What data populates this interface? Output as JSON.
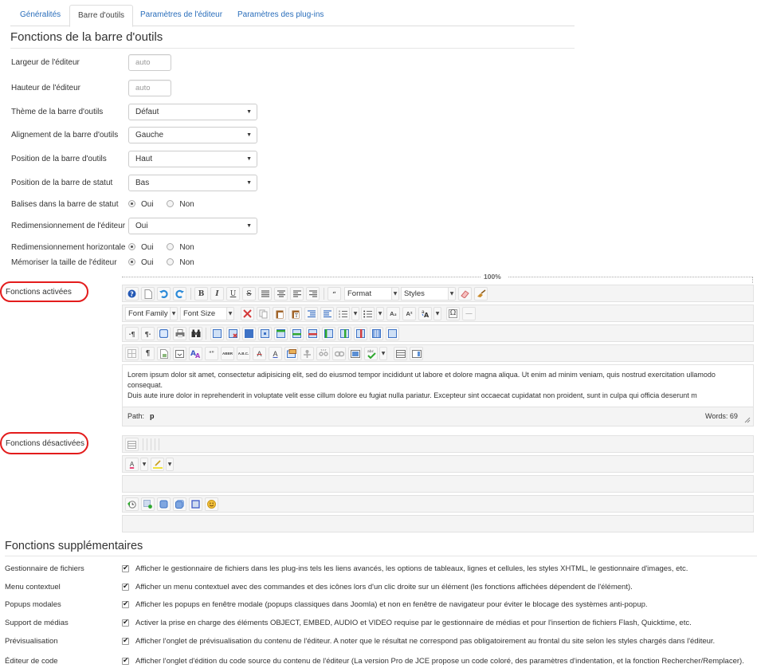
{
  "tabs": [
    {
      "label": "Généralités",
      "active": false
    },
    {
      "label": "Barre d'outils",
      "active": true
    },
    {
      "label": "Paramètres de l'éditeur",
      "active": false
    },
    {
      "label": "Paramètres des plug-ins",
      "active": false
    }
  ],
  "section1": {
    "title": "Fonctions de la barre d'outils",
    "fields": {
      "width": {
        "label": "Largeur de l'éditeur",
        "placeholder": "auto"
      },
      "height": {
        "label": "Hauteur de l'éditeur",
        "placeholder": "auto"
      },
      "theme": {
        "label": "Thème de la barre d'outils",
        "value": "Défaut"
      },
      "align": {
        "label": "Alignement de la barre d'outils",
        "value": "Gauche"
      },
      "position": {
        "label": "Position de la barre d'outils",
        "value": "Haut"
      },
      "status_position": {
        "label": "Position de la barre de statut",
        "value": "Bas"
      },
      "status_tags": {
        "label": "Balises dans la barre de statut",
        "yes": "Oui",
        "no": "Non",
        "selected": "Oui"
      },
      "resize": {
        "label": "Redimensionnement de l'éditeur",
        "value": "Oui"
      },
      "resize_h": {
        "label": "Redimensionnement horizontale",
        "yes": "Oui",
        "no": "Non",
        "selected": "Oui"
      },
      "remember_size": {
        "label": "Mémoriser la taille de l'éditeur",
        "yes": "Oui",
        "no": "Non",
        "selected": "Oui"
      }
    },
    "caret": "▼"
  },
  "editor": {
    "enabled_label": "Fonctions activées",
    "disabled_label": "Fonctions désactivées",
    "zoom": "100%",
    "format_label": "Format",
    "styles_label": "Styles",
    "font_family_label": "Font Family",
    "font_size_label": "Font Size",
    "content_line1": "Lorem ipsum dolor sit amet, consectetur adipisicing elit, sed do eiusmod tempor incididunt ut labore et dolore magna aliqua. Ut enim ad minim veniam, quis nostrud exercitation ullamodo consequat.",
    "content_line2": "Duis aute irure dolor in reprehenderit in voluptate velit esse cillum dolore eu fugiat nulla pariatur. Excepteur sint occaecat cupidatat non proident, sunt in culpa qui officia deserunt m",
    "path_label": "Path:",
    "path_value": "p",
    "words_label": "Words: 69",
    "glyphs": {
      "help": "?",
      "bold": "B",
      "italic": "I",
      "underline": "U",
      "strike": "S",
      "blockquote": "“",
      "sub": "A₂",
      "sup": "A²",
      "omega": "Ω",
      "hr": "—",
      "ltr": "·¶",
      "rtl": "¶·",
      "pilcrow": "¶",
      "quote": "“”",
      "abbr": "ABBR",
      "acronym": "A.B.C.",
      "del": "A",
      "ins": "A",
      "color_a": "A"
    }
  },
  "section2": {
    "title": "Fonctions supplémentaires",
    "items": [
      {
        "label": "Gestionnaire de fichiers",
        "checked": true,
        "desc": "Afficher le gestionnaire de fichiers dans les plug-ins tels les liens avancés, les options de tableaux, lignes et cellules, les styles XHTML, le gestionnaire d'images, etc."
      },
      {
        "label": "Menu contextuel",
        "checked": true,
        "desc": "Afficher un menu contextuel avec des commandes et des icônes lors d'un clic droite sur un élément (les fonctions affichées dépendent de l'élément)."
      },
      {
        "label": "Popups modales",
        "checked": true,
        "desc": "Afficher les popups en fenêtre modale (popups classiques dans Joomla) et non en fenêtre de navigateur pour éviter le blocage des systèmes anti-popup."
      },
      {
        "label": "Support de médias",
        "checked": true,
        "desc": "Activer la prise en charge des éléments OBJECT, EMBED, AUDIO et VIDEO requise par le gestionnaire de médias et pour l'insertion de fichiers Flash, Quicktime, etc."
      },
      {
        "label": "Prévisualisation",
        "checked": true,
        "desc": "Afficher l'onglet de prévisualisation du contenu de l'éditeur. A noter que le résultat ne correspond pas obligatoirement au frontal du site selon les styles chargés dans l'éditeur."
      },
      {
        "label": "Éditeur de code",
        "checked": true,
        "desc": "Afficher l'onglet d'édition du code source du contenu de l'éditeur (La version Pro de JCE propose un code coloré, des paramètres d'indentation, et la fonction Rechercher/Remplacer)."
      }
    ]
  },
  "colors": {
    "link": "#2a6ebb",
    "highlight_oval": "#e31c1c",
    "toolbar_bg": "#f4f4f4"
  }
}
